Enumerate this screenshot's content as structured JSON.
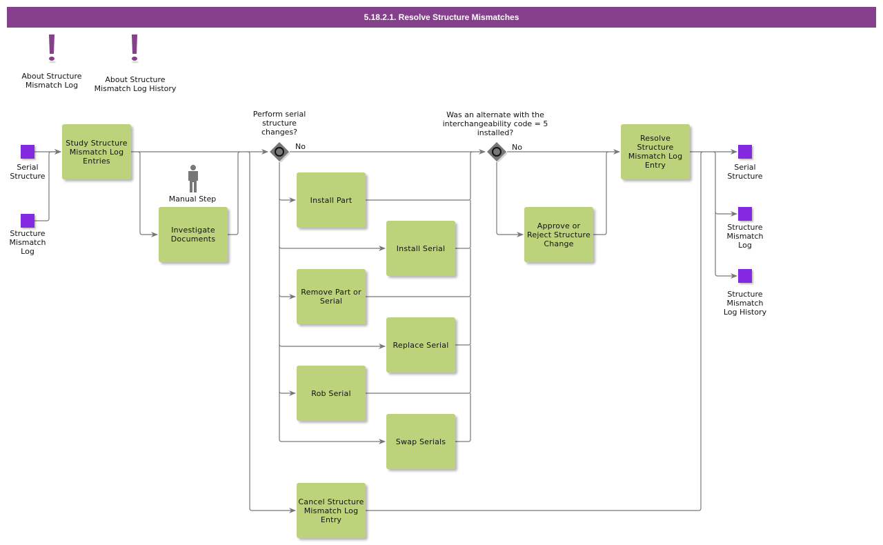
{
  "title": "5.18.2.1. Resolve Structure Mismatches",
  "colors": {
    "title_bar": "#84408a",
    "task_fill": "#bcd37c",
    "data_object": "#8529e0",
    "gateway": "#777777",
    "connector": "#777777",
    "annotation_icon": "#84408a"
  },
  "annotations": [
    {
      "icon": "exclamation-icon",
      "label": "About Structure\nMismatch Log"
    },
    {
      "icon": "exclamation-icon",
      "label": "About Structure\nMismatch Log History"
    }
  ],
  "inputs": [
    {
      "label": "Serial\nStructure"
    },
    {
      "label": "Structure\nMismatch\nLog"
    }
  ],
  "outputs": [
    {
      "label": "Serial\nStructure"
    },
    {
      "label": "Structure\nMismatch\nLog"
    },
    {
      "label": "Structure\nMismatch\nLog History"
    }
  ],
  "manual_step": {
    "icon": "person-icon",
    "label": "Manual Step"
  },
  "tasks": {
    "study": "Study Structure Mismatch Log Entries",
    "investigate": "Investigate Documents",
    "install_part": "Install Part",
    "install_serial": "Install Serial",
    "remove_part": "Remove Part or Serial",
    "replace_serial": "Replace Serial",
    "rob_serial": "Rob Serial",
    "swap_serials": "Swap Serials",
    "cancel": "Cancel Structure Mismatch Log Entry",
    "approve": "Approve or Reject Structure Change",
    "resolve": "Resolve Structure Mismatch Log Entry"
  },
  "gateways": [
    {
      "question": "Perform serial\nstructure\nchanges?",
      "branch_label": "No"
    },
    {
      "question": "Was an alternate with the\ninterchangeability code = 5\ninstalled?",
      "branch_label": "No"
    }
  ]
}
